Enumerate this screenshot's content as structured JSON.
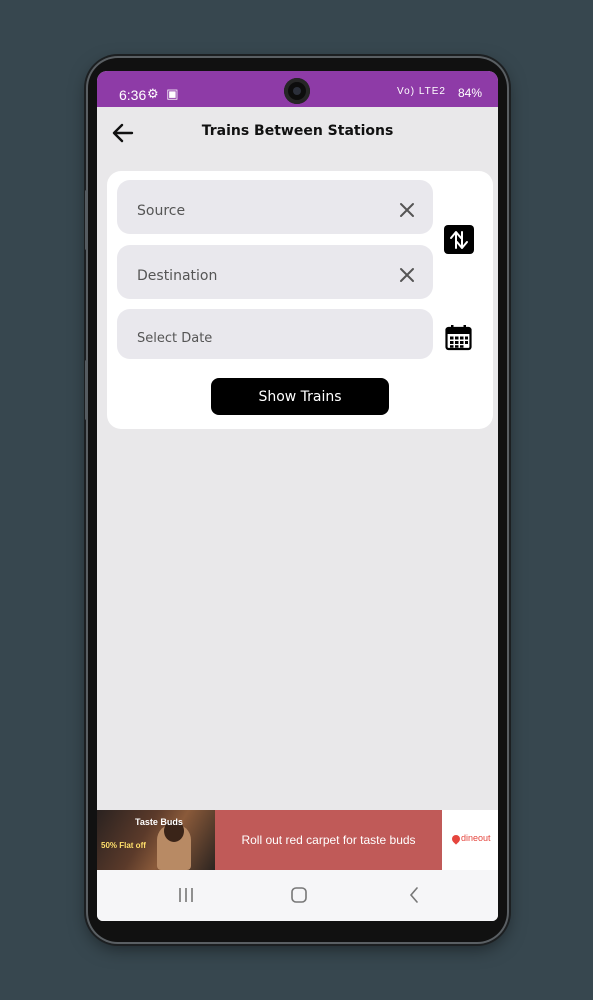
{
  "status_bar": {
    "time": "6:36",
    "battery": "84%",
    "network": "Vo) LTE2"
  },
  "app_bar": {
    "title": "Trains Between Stations",
    "back_icon": "arrow-left-icon"
  },
  "form": {
    "source_label": "Source",
    "destination_label": "Destination",
    "date_label": "Select Date",
    "show_button_label": "Show Trains",
    "swap_icon": "swap-vertical-icon",
    "calendar_icon": "calendar-icon",
    "clear_icon": "close-icon"
  },
  "ad": {
    "image_title": "Taste Buds",
    "image_offer": "50% Flat off",
    "headline": "Roll out red carpet for taste buds",
    "brand": "dineout"
  },
  "colors": {
    "status_bar": "#8e3ba7",
    "background": "#e9e8ea",
    "button": "#000000",
    "ad_banner": "#c05a58"
  }
}
